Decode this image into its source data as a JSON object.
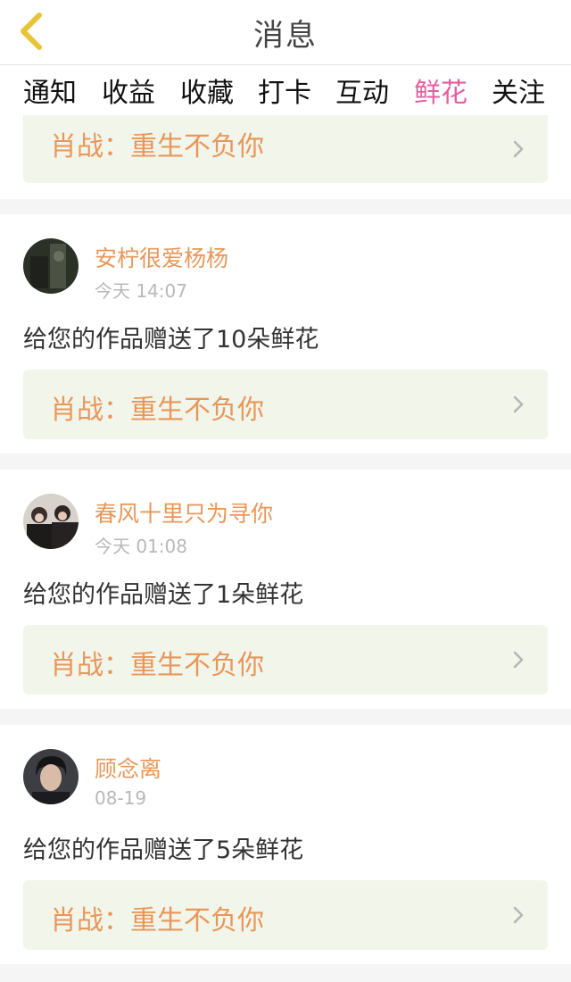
{
  "header": {
    "title": "消息",
    "back_icon": "chevron-left-icon",
    "back_color": "#e8c43a"
  },
  "tabs": [
    {
      "label": "通知"
    },
    {
      "label": "收益"
    },
    {
      "label": "收藏"
    },
    {
      "label": "打卡"
    },
    {
      "label": "互动"
    },
    {
      "label": "鲜花",
      "active": true
    },
    {
      "label": "关注"
    }
  ],
  "colors": {
    "accent": "#e060a0",
    "username": "#e8975a",
    "link_bg": "#f2f5ea"
  },
  "partial_card": {
    "work_title": "肖战：重生不负你"
  },
  "notifications": [
    {
      "username": "安柠很爱杨杨",
      "time": "今天 14:07",
      "message": "给您的作品赠送了10朵鲜花",
      "work_title": "肖战：重生不负你"
    },
    {
      "username": "春风十里只为寻你",
      "time": "今天 01:08",
      "message": "给您的作品赠送了1朵鲜花",
      "work_title": "肖战：重生不负你"
    },
    {
      "username": "顾念离",
      "time": "08-19",
      "message": "给您的作品赠送了5朵鲜花",
      "work_title": "肖战：重生不负你"
    }
  ]
}
